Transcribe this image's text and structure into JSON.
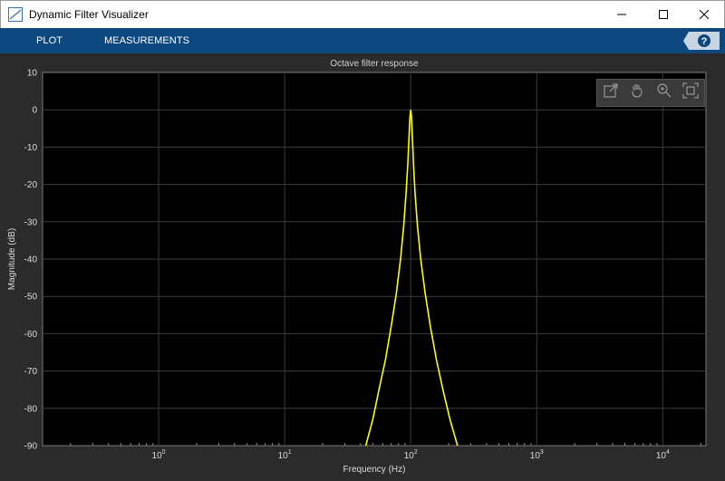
{
  "window": {
    "title": "Dynamic Filter Visualizer",
    "controls": [
      "minimize-icon",
      "maximize-icon",
      "close-icon"
    ]
  },
  "toolstrip": {
    "tabs": [
      {
        "label": "PLOT"
      },
      {
        "label": "MEASUREMENTS"
      }
    ],
    "help_icon": "question-mark-icon"
  },
  "plot_tools": [
    "data-cursor-icon",
    "pan-hand-icon",
    "zoom-in-icon",
    "zoom-fit-icon"
  ],
  "colors": {
    "trace": "#ffff00",
    "background": "#000000",
    "frame": "#2b2b2b",
    "toolstrip": "#0d477f"
  },
  "chart_data": {
    "type": "line",
    "title": "Octave filter response",
    "xlabel": "Frequency (Hz)",
    "ylabel": "Magnitude (dB)",
    "xscale": "log",
    "xlim": [
      0.12,
      22000
    ],
    "ylim": [
      -90,
      10
    ],
    "grid": true,
    "x_tick_labels": [
      {
        "base": "10",
        "exp": "0",
        "value": 1
      },
      {
        "base": "10",
        "exp": "1",
        "value": 10
      },
      {
        "base": "10",
        "exp": "2",
        "value": 100
      },
      {
        "base": "10",
        "exp": "3",
        "value": 1000
      },
      {
        "base": "10",
        "exp": "4",
        "value": 10000
      }
    ],
    "y_ticks": [
      10,
      0,
      -10,
      -20,
      -30,
      -40,
      -50,
      -60,
      -70,
      -80,
      -90
    ],
    "series": [
      {
        "color": "#ffff00",
        "x": [
          44,
          50,
          56,
          63,
          70,
          77,
          83,
          88,
          92,
          95,
          97,
          98.5,
          100,
          101.5,
          103,
          105,
          108,
          113,
          120,
          130,
          143,
          160,
          180,
          205,
          235
        ],
        "y": [
          -90,
          -83,
          -75,
          -67,
          -58,
          -49,
          -40,
          -31,
          -22,
          -14,
          -7,
          -2,
          0,
          -2,
          -7,
          -14,
          -22,
          -31,
          -40,
          -49,
          -58,
          -67,
          -75,
          -83,
          -90
        ]
      }
    ]
  }
}
